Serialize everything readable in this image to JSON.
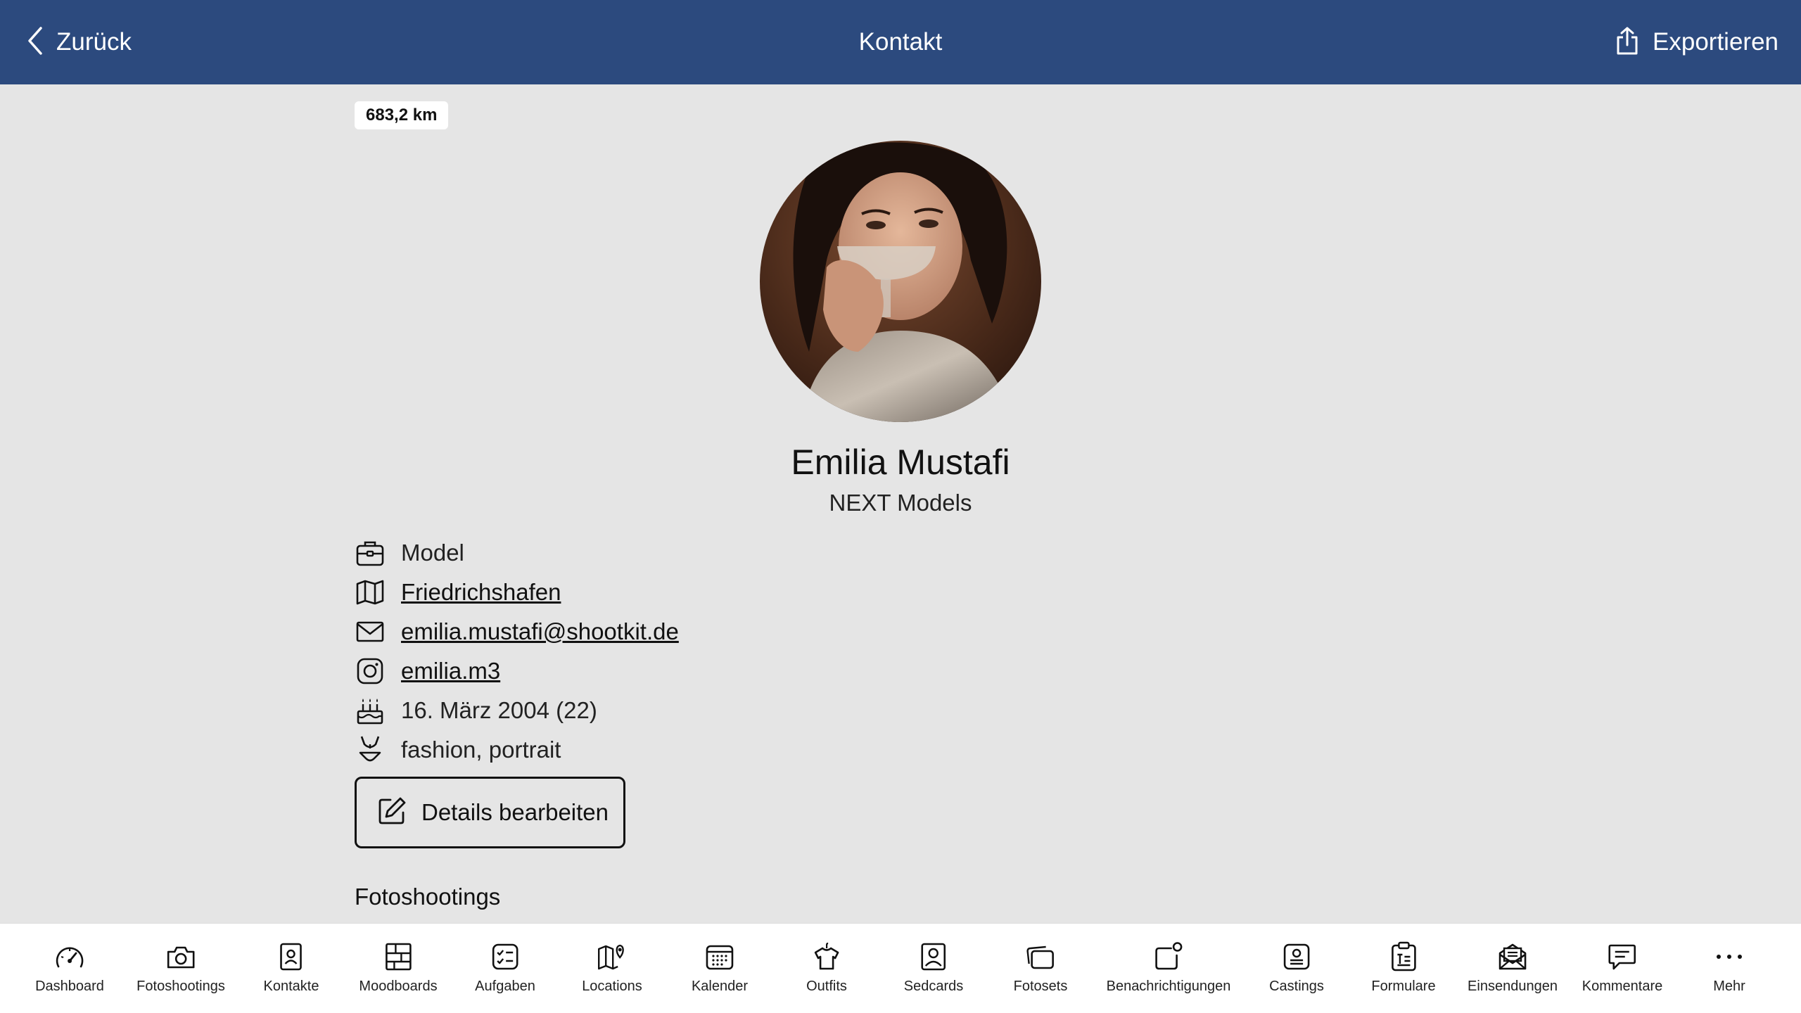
{
  "header": {
    "back_label": "Zurück",
    "title": "Kontakt",
    "export_label": "Exportieren",
    "background": "#2c4a7e"
  },
  "contact": {
    "distance": "683,2 km",
    "name": "Emilia Mustafi",
    "company": "NEXT Models",
    "role": "Model",
    "city": "Friedrichshafen",
    "email": "emilia.mustafi@shootkit.de",
    "instagram": "emilia.m3",
    "birthday": "16. März 2004 (22)",
    "categories": "fashion, portrait"
  },
  "actions": {
    "edit_label": "Details bearbeiten"
  },
  "sections": {
    "photoshoots_title": "Fotoshootings"
  },
  "tabbar": {
    "items": [
      {
        "label": "Dashboard",
        "icon": "gauge-icon"
      },
      {
        "label": "Fotoshootings",
        "icon": "camera-icon"
      },
      {
        "label": "Kontakte",
        "icon": "contact-card-icon"
      },
      {
        "label": "Moodboards",
        "icon": "moodboard-icon"
      },
      {
        "label": "Aufgaben",
        "icon": "checklist-icon"
      },
      {
        "label": "Locations",
        "icon": "map-pin-icon"
      },
      {
        "label": "Kalender",
        "icon": "calendar-icon"
      },
      {
        "label": "Outfits",
        "icon": "shirt-icon"
      },
      {
        "label": "Sedcards",
        "icon": "portrait-card-icon"
      },
      {
        "label": "Fotosets",
        "icon": "photo-stack-icon"
      },
      {
        "label": "Benachrichtigungen",
        "icon": "notification-icon"
      },
      {
        "label": "Castings",
        "icon": "casting-icon"
      },
      {
        "label": "Formulare",
        "icon": "clipboard-form-icon"
      },
      {
        "label": "Einsendungen",
        "icon": "envelope-open-icon"
      },
      {
        "label": "Kommentare",
        "icon": "comment-icon"
      },
      {
        "label": "Mehr",
        "icon": "ellipsis-icon"
      }
    ]
  }
}
